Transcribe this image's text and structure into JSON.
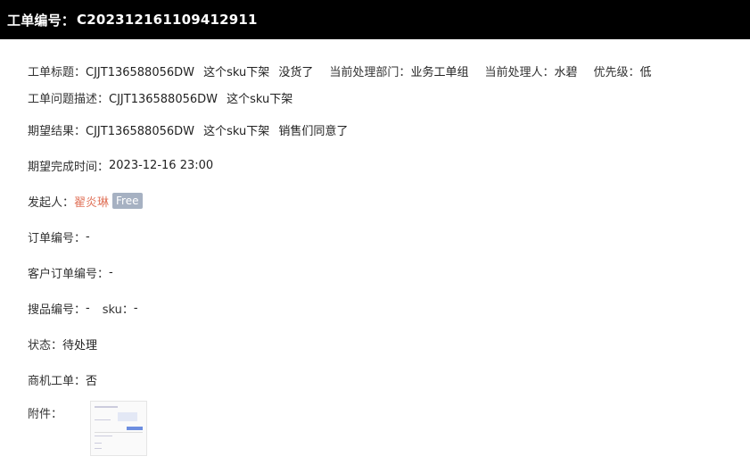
{
  "header": {
    "title_label": "工单编号：",
    "title_code": "C202312161109412911"
  },
  "row1": {
    "title_label": "工单标题：",
    "title_value": "CJJT136588056DW 这个sku下架 没货了",
    "dept_label": "当前处理部门：",
    "dept_value": "业务工单组",
    "handler_label": "当前处理人：",
    "handler_value": "水碧",
    "priority_label": "优先级：",
    "priority_value": "低"
  },
  "row2": {
    "label": "工单问题描述：",
    "value": "CJJT136588056DW 这个sku下架"
  },
  "expected_result": {
    "label": "期望结果：",
    "value": "CJJT136588056DW 这个sku下架 销售们同意了"
  },
  "expected_time": {
    "label": "期望完成时间：",
    "value": "2023-12-16 23:00"
  },
  "initiator": {
    "label": "发起人：",
    "name": "翟炎琳",
    "badge": "Free"
  },
  "order_no": {
    "label": "订单编号：",
    "value": "-"
  },
  "customer_order_no": {
    "label": "客户订单编号：",
    "value": "-"
  },
  "search_no": {
    "label": "搜品编号：",
    "value": "-",
    "sku_label": "sku：",
    "sku_value": "-"
  },
  "status": {
    "label": "状态：",
    "value": "待处理"
  },
  "opportunity": {
    "label": "商机工单：",
    "value": "否"
  },
  "attachment": {
    "label": "附件："
  }
}
